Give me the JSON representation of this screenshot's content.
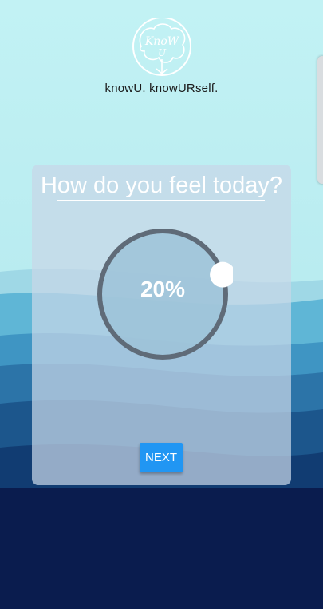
{
  "app": {
    "logo_text": "KnoW U",
    "tagline": "knowU. knowURself."
  },
  "mood_card": {
    "question": "How do you feel today?",
    "dial": {
      "value": 0.2,
      "value_label": "20%"
    },
    "next_label": "NEXT"
  },
  "colors": {
    "sky": "#c5f0f2",
    "accent_button": "#2196f3",
    "dial_track": "#5f6b78",
    "deep_sea": "#0a1c4e"
  }
}
